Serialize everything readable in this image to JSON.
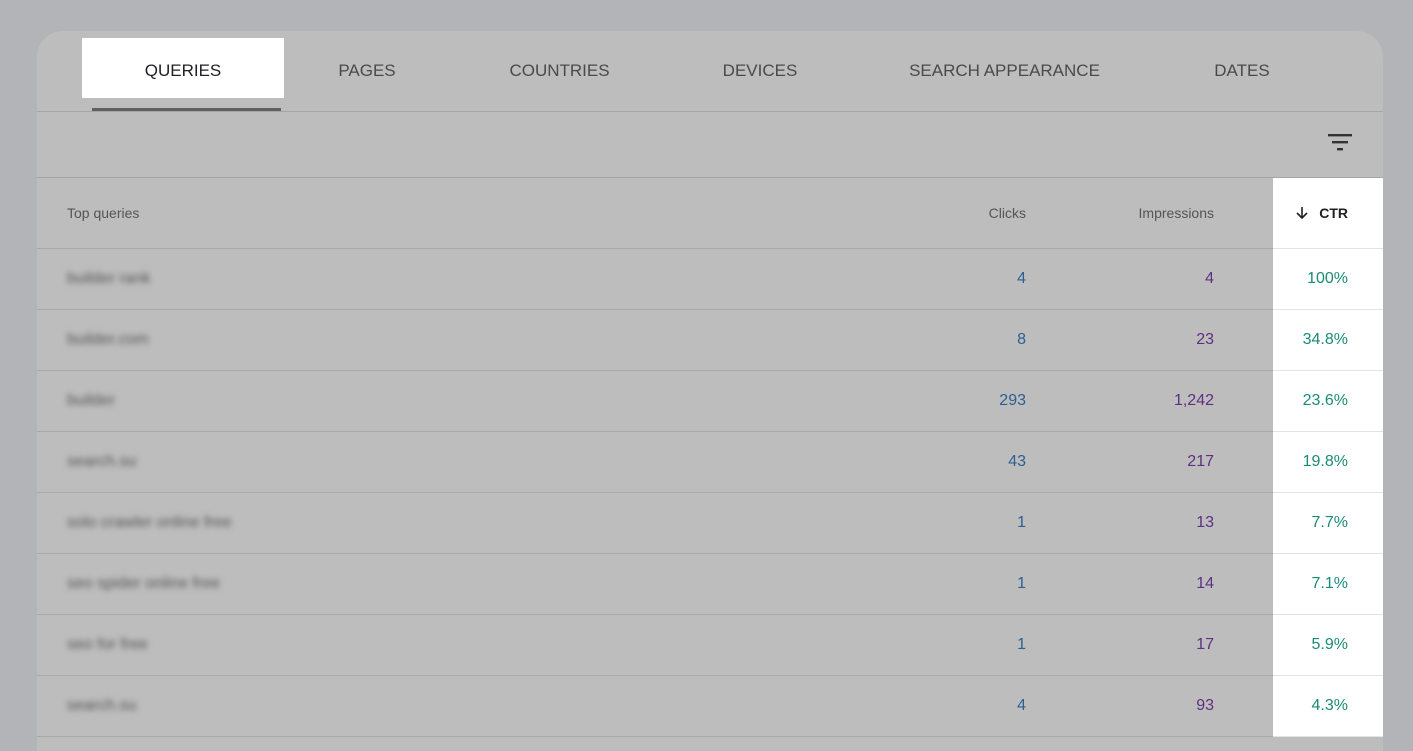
{
  "tabs": [
    {
      "label": "QUERIES",
      "active": true
    },
    {
      "label": "PAGES"
    },
    {
      "label": "COUNTRIES"
    },
    {
      "label": "DEVICES"
    },
    {
      "label": "SEARCH APPEARANCE"
    },
    {
      "label": "DATES"
    }
  ],
  "filter_icon": "filter-list-icon",
  "table": {
    "headers": {
      "query": "Top queries",
      "clicks": "Clicks",
      "impressions": "Impressions",
      "ctr": "CTR",
      "sort_icon": "arrow-down-icon"
    },
    "rows": [
      {
        "query": "builder rank",
        "clicks": "4",
        "impressions": "4",
        "ctr": "100%"
      },
      {
        "query": "builder.com",
        "clicks": "8",
        "impressions": "23",
        "ctr": "34.8%"
      },
      {
        "query": "builder",
        "clicks": "293",
        "impressions": "1,242",
        "ctr": "23.6%"
      },
      {
        "query": "search.su",
        "clicks": "43",
        "impressions": "217",
        "ctr": "19.8%"
      },
      {
        "query": "solo crawler online free",
        "clicks": "1",
        "impressions": "13",
        "ctr": "7.7%"
      },
      {
        "query": "seo spider online free",
        "clicks": "1",
        "impressions": "14",
        "ctr": "7.1%"
      },
      {
        "query": "seo for free",
        "clicks": "1",
        "impressions": "17",
        "ctr": "5.9%"
      },
      {
        "query": "search.su",
        "clicks": "4",
        "impressions": "93",
        "ctr": "4.3%"
      }
    ]
  },
  "colors": {
    "clicks": "#2c5f94",
    "impressions": "#5e2f82",
    "ctr": "#1a8a78"
  }
}
